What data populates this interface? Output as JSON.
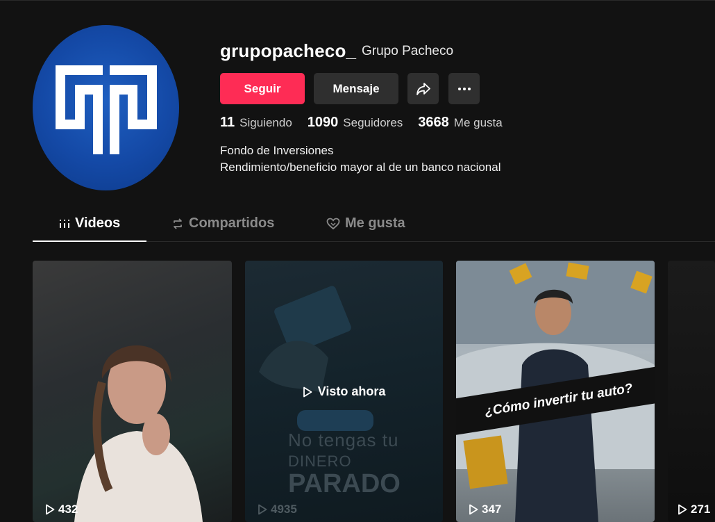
{
  "profile": {
    "username": "grupopacheco_",
    "nickname": "Grupo Pacheco",
    "avatar_icon": "gp-logo-icon"
  },
  "actions": {
    "follow": "Seguir",
    "message": "Mensaje",
    "share_icon": "share-icon",
    "more_icon": "more-icon"
  },
  "stats": {
    "following_count": "11",
    "following_label": "Siguiendo",
    "followers_count": "1090",
    "followers_label": "Seguidores",
    "likes_count": "3668",
    "likes_label": "Me gusta"
  },
  "bio": {
    "line1": "Fondo de Inversiones",
    "line2": "Rendimiento/beneficio mayor al de un banco nacional"
  },
  "tabs": [
    {
      "label": "Videos",
      "icon": "grid-icon",
      "active": true
    },
    {
      "label": "Compartidos",
      "icon": "repost-icon",
      "active": false
    },
    {
      "label": "Me gusta",
      "icon": "heart-icon",
      "active": false
    }
  ],
  "videos": [
    {
      "views": "432"
    },
    {
      "views": "4935",
      "watched_label": "Visto ahora",
      "overlay_line1": "No tengas tu",
      "overlay_line2": "DINERO",
      "overlay_line3": "PARADO"
    },
    {
      "views": "347",
      "banner": "¿Cómo invertir tu auto?"
    },
    {
      "views": "271"
    }
  ],
  "colors": {
    "background": "#121212",
    "accent": "#fe2c55",
    "button_secondary": "#2f2f2f"
  }
}
